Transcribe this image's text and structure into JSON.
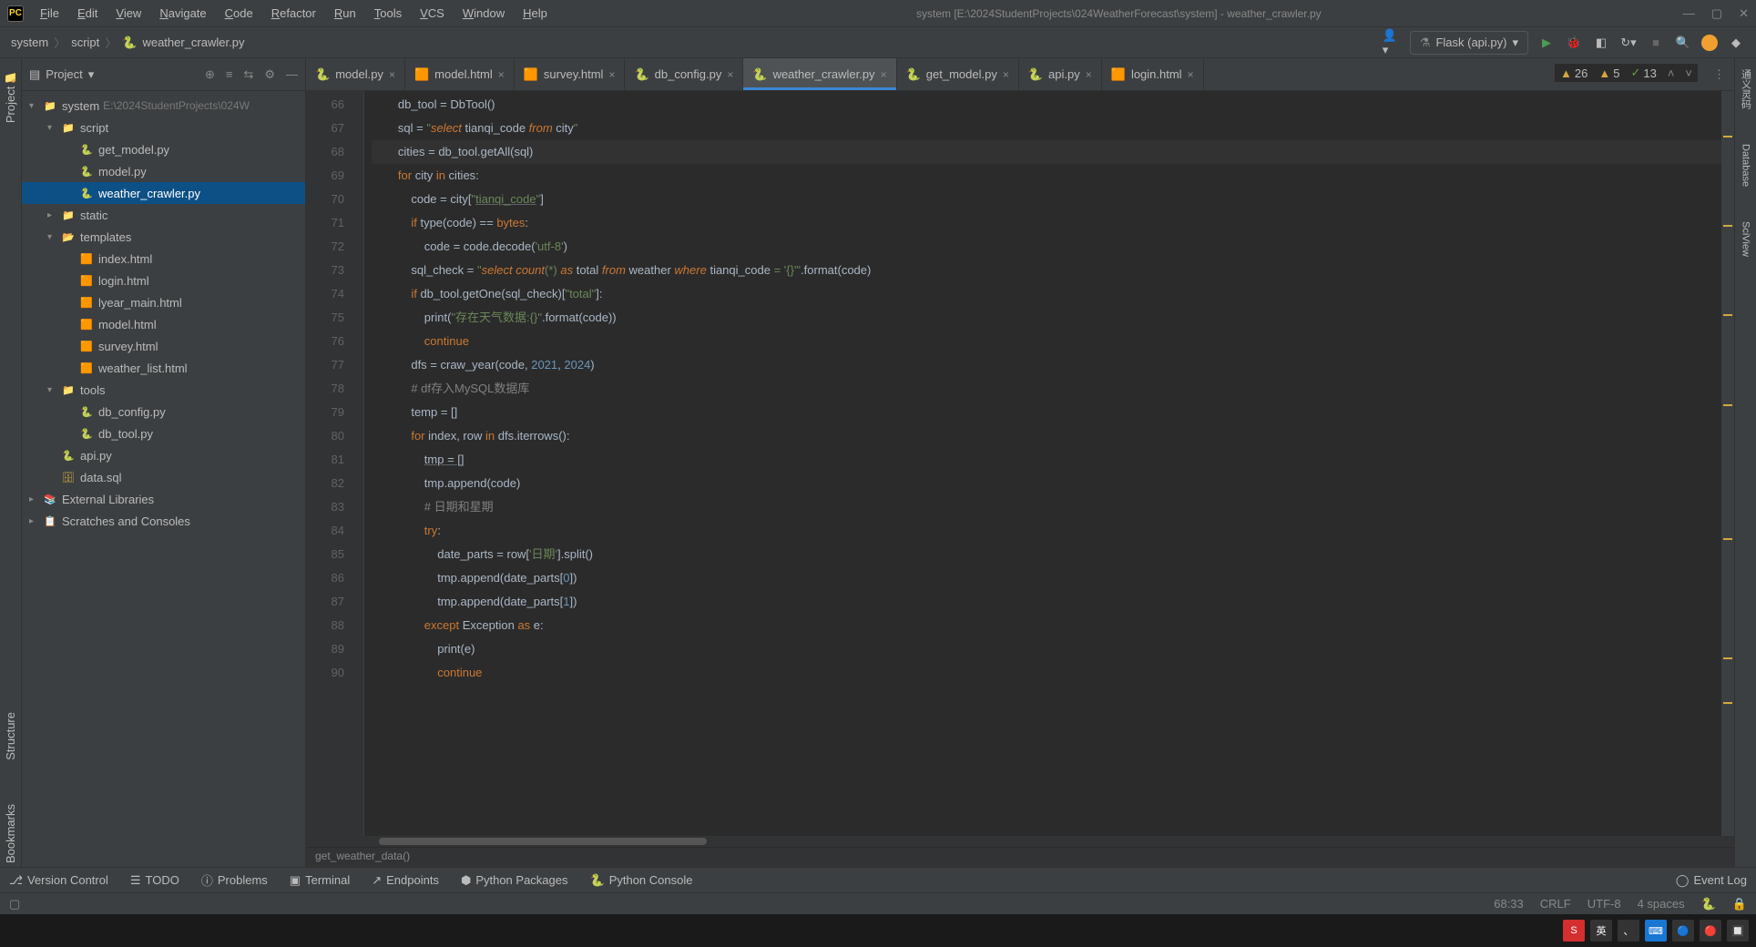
{
  "window": {
    "title": "system [E:\\2024StudentProjects\\024WeatherForecast\\system] - weather_crawler.py"
  },
  "menu": [
    "File",
    "Edit",
    "View",
    "Navigate",
    "Code",
    "Refactor",
    "Run",
    "Tools",
    "VCS",
    "Window",
    "Help"
  ],
  "breadcrumb": [
    "system",
    "script",
    "weather_crawler.py"
  ],
  "run_config": "Flask (api.py)",
  "project_panel": {
    "title": "Project"
  },
  "tree": [
    {
      "depth": 0,
      "arrow": "▾",
      "icon": "folder",
      "label": "system",
      "path": "E:\\2024StudentProjects\\024W"
    },
    {
      "depth": 1,
      "arrow": "▾",
      "icon": "folder",
      "label": "script"
    },
    {
      "depth": 2,
      "arrow": "",
      "icon": "py",
      "label": "get_model.py"
    },
    {
      "depth": 2,
      "arrow": "",
      "icon": "py",
      "label": "model.py"
    },
    {
      "depth": 2,
      "arrow": "",
      "icon": "py",
      "label": "weather_crawler.py",
      "selected": true
    },
    {
      "depth": 1,
      "arrow": "▸",
      "icon": "folder",
      "label": "static"
    },
    {
      "depth": 1,
      "arrow": "▾",
      "icon": "folder-tpl",
      "label": "templates"
    },
    {
      "depth": 2,
      "arrow": "",
      "icon": "html",
      "label": "index.html"
    },
    {
      "depth": 2,
      "arrow": "",
      "icon": "html",
      "label": "login.html"
    },
    {
      "depth": 2,
      "arrow": "",
      "icon": "html",
      "label": "lyear_main.html"
    },
    {
      "depth": 2,
      "arrow": "",
      "icon": "html",
      "label": "model.html"
    },
    {
      "depth": 2,
      "arrow": "",
      "icon": "html",
      "label": "survey.html"
    },
    {
      "depth": 2,
      "arrow": "",
      "icon": "html",
      "label": "weather_list.html"
    },
    {
      "depth": 1,
      "arrow": "▾",
      "icon": "folder",
      "label": "tools"
    },
    {
      "depth": 2,
      "arrow": "",
      "icon": "py",
      "label": "db_config.py"
    },
    {
      "depth": 2,
      "arrow": "",
      "icon": "py",
      "label": "db_tool.py"
    },
    {
      "depth": 1,
      "arrow": "",
      "icon": "py",
      "label": "api.py"
    },
    {
      "depth": 1,
      "arrow": "",
      "icon": "sql",
      "label": "data.sql"
    },
    {
      "depth": 0,
      "arrow": "▸",
      "icon": "lib",
      "label": "External Libraries"
    },
    {
      "depth": 0,
      "arrow": "▸",
      "icon": "scratch",
      "label": "Scratches and Consoles"
    }
  ],
  "tabs": [
    {
      "icon": "py",
      "label": "model.py"
    },
    {
      "icon": "html",
      "label": "model.html"
    },
    {
      "icon": "html",
      "label": "survey.html"
    },
    {
      "icon": "py",
      "label": "db_config.py"
    },
    {
      "icon": "py",
      "label": "weather_crawler.py",
      "active": true
    },
    {
      "icon": "py",
      "label": "get_model.py"
    },
    {
      "icon": "py",
      "label": "api.py"
    },
    {
      "icon": "html",
      "label": "login.html"
    }
  ],
  "inspection": {
    "warn1": "26",
    "warn2": "5",
    "ok": "13"
  },
  "code_lines": [
    {
      "n": 66,
      "html": "db_tool = DbTool()"
    },
    {
      "n": 67,
      "html": "sql = <span class='str'>\"</span><span class='sql-kw'>select</span><span class='str'> </span><span class='sql-id'>tianqi_code</span><span class='str'> </span><span class='sql-kw'>from</span><span class='str'> </span><span class='sql-id'>city</span><span class='str'>\"</span>"
    },
    {
      "n": 68,
      "cursor": true,
      "html": "cities = db_tool.getAll(sql)"
    },
    {
      "n": 69,
      "html": "<span class='kw'>for</span> city <span class='kw'>in</span> cities:"
    },
    {
      "n": 70,
      "html": "    code = city[<span class='str'>\"<span class='ul'>tianqi_code</span>\"</span>]"
    },
    {
      "n": 71,
      "html": "    <span class='kw'>if</span> <span class='fn'>type</span>(code) == <span class='kw'>bytes</span>:"
    },
    {
      "n": 72,
      "html": "        code = code.decode(<span class='str'>'utf-8'</span>)"
    },
    {
      "n": 73,
      "html": "    sql_check = <span class='str'>\"</span><span class='sql-kw'>select</span><span class='str'> </span><span class='sql-kw'><i>count</i></span><span class='str'>(*) </span><span class='sql-kw'>as</span><span class='str'> </span><span class='sql-id'>total</span><span class='str'> </span><span class='sql-kw'>from</span><span class='str'> </span><span class='sql-id'>weather</span><span class='str'> </span><span class='sql-kw'>where</span><span class='str'> </span><span class='sql-id'>tianqi_code</span><span class='str'> = </span><span class='str'>'{}'\"</span>.format(code)"
    },
    {
      "n": 74,
      "html": "    <span class='kw'>if</span> db_tool.getOne(sql_check)[<span class='str'>\"total\"</span>]:"
    },
    {
      "n": 75,
      "html": "        <span class='fn'>print</span>(<span class='str'>\"存在天气数据:{}\"</span>.format(code))"
    },
    {
      "n": 76,
      "html": "        <span class='kw'>continue</span>"
    },
    {
      "n": 77,
      "html": "    dfs = craw_year(code, <span class='num'>2021</span>, <span class='num'>2024</span>)"
    },
    {
      "n": 78,
      "html": "    <span class='cmt'># df存入MySQL数据库</span>"
    },
    {
      "n": 79,
      "html": "    temp = []"
    },
    {
      "n": 80,
      "html": "    <span class='kw'>for</span> index, row <span class='kw'>in</span> dfs.iterrows():"
    },
    {
      "n": 81,
      "html": "        <span class='ul'>tmp = []</span>"
    },
    {
      "n": 82,
      "html": "        tmp.append(code)"
    },
    {
      "n": 83,
      "html": "        <span class='cmt'># 日期和星期</span>"
    },
    {
      "n": 84,
      "html": "        <span class='kw'>try</span>:"
    },
    {
      "n": 85,
      "html": "            date_parts = row[<span class='str'>'日期'</span>].split()"
    },
    {
      "n": 86,
      "html": "            tmp.append(date_parts[<span class='num'>0</span>])"
    },
    {
      "n": 87,
      "html": "            tmp.append(date_parts[<span class='num'>1</span>])"
    },
    {
      "n": 88,
      "html": "        <span class='kw'>except</span> Exception <span class='kw'>as</span> e:"
    },
    {
      "n": 89,
      "html": "            <span class='fn'>print</span>(e)"
    },
    {
      "n": 90,
      "html": "            <span class='kw'>continue</span>"
    }
  ],
  "bottom_breadcrumb": "get_weather_data()",
  "bottom_tools": [
    "Version Control",
    "TODO",
    "Problems",
    "Terminal",
    "Endpoints",
    "Python Packages",
    "Python Console"
  ],
  "event_log": "Event Log",
  "status": {
    "pos": "68:33",
    "line_sep": "CRLF",
    "encoding": "UTF-8",
    "indent": "4 spaces"
  },
  "left_tabs": [
    "Project",
    "Structure",
    "Bookmarks"
  ],
  "right_tabs": [
    "通义灵码",
    "Database",
    "SciView"
  ],
  "taskbar": [
    "S",
    "英",
    "、",
    "⌨",
    "🔵",
    "🔴",
    "🔲"
  ]
}
